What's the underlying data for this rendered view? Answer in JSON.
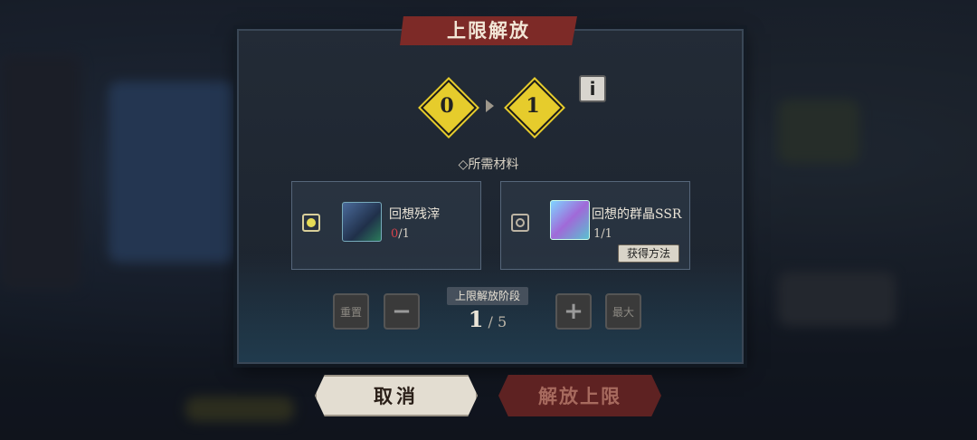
{
  "dialog": {
    "title": "上限解放",
    "level_from": "0",
    "level_to": "1",
    "info_icon": "info-icon"
  },
  "materials": {
    "header": "◇所需材料",
    "items": [
      {
        "name": "回想残滓",
        "have": "0",
        "need": "/1",
        "selected": true
      },
      {
        "name": "回想的群晶SSR",
        "have": "1",
        "need": "/1",
        "selected": false,
        "obtain_label": "获得方法"
      }
    ]
  },
  "stage": {
    "label": "上限解放阶段",
    "current": "1",
    "total": " / 5",
    "reset_label": "重置",
    "minus_icon": "minus-icon",
    "plus_icon": "plus-icon",
    "max_label": "最大"
  },
  "actions": {
    "cancel_label": "取消",
    "confirm_label": "解放上限"
  },
  "colors": {
    "accent_red": "#7d2a27",
    "diamond_yellow": "#e6cc2c",
    "insufficient": "#d6424a"
  }
}
